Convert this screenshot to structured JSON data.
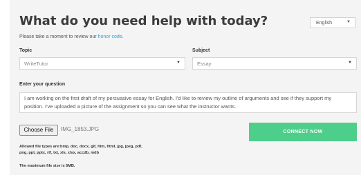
{
  "header": {
    "title": "What do you need help with today?",
    "subtitle_prefix": "Please take a moment to review our ",
    "honor_code_link": "honor code",
    "subtitle_suffix": ".",
    "language": "English"
  },
  "form": {
    "topic_label": "Topic",
    "topic_value": "WriteTutor",
    "subject_label": "Subject",
    "subject_value": "Essay",
    "question_label": "Enter your question",
    "question_text": "I am working on the first draft of my persuasive essay for English. I'd like to review my outline of arguments and see if they support my position. I've uploaded a picture of the assignment so you can see what the instructor wants.",
    "choose_file_label": "Choose File",
    "file_name": "IMG_1853.JPG",
    "connect_label": "CONNECT NOW",
    "allowed_types_line1": "Allowed file types are:bmp, doc, docx, gif, htm, html, jpg, jpeg, pdf,",
    "allowed_types_line2": "png, ppt, pptx, rtf, txt, xls, xlsx, accdb, mdb",
    "max_size": "The maximum file size is 5MB."
  },
  "colors": {
    "connect_button": "#4dcf8b",
    "link": "#3b9bd6"
  }
}
